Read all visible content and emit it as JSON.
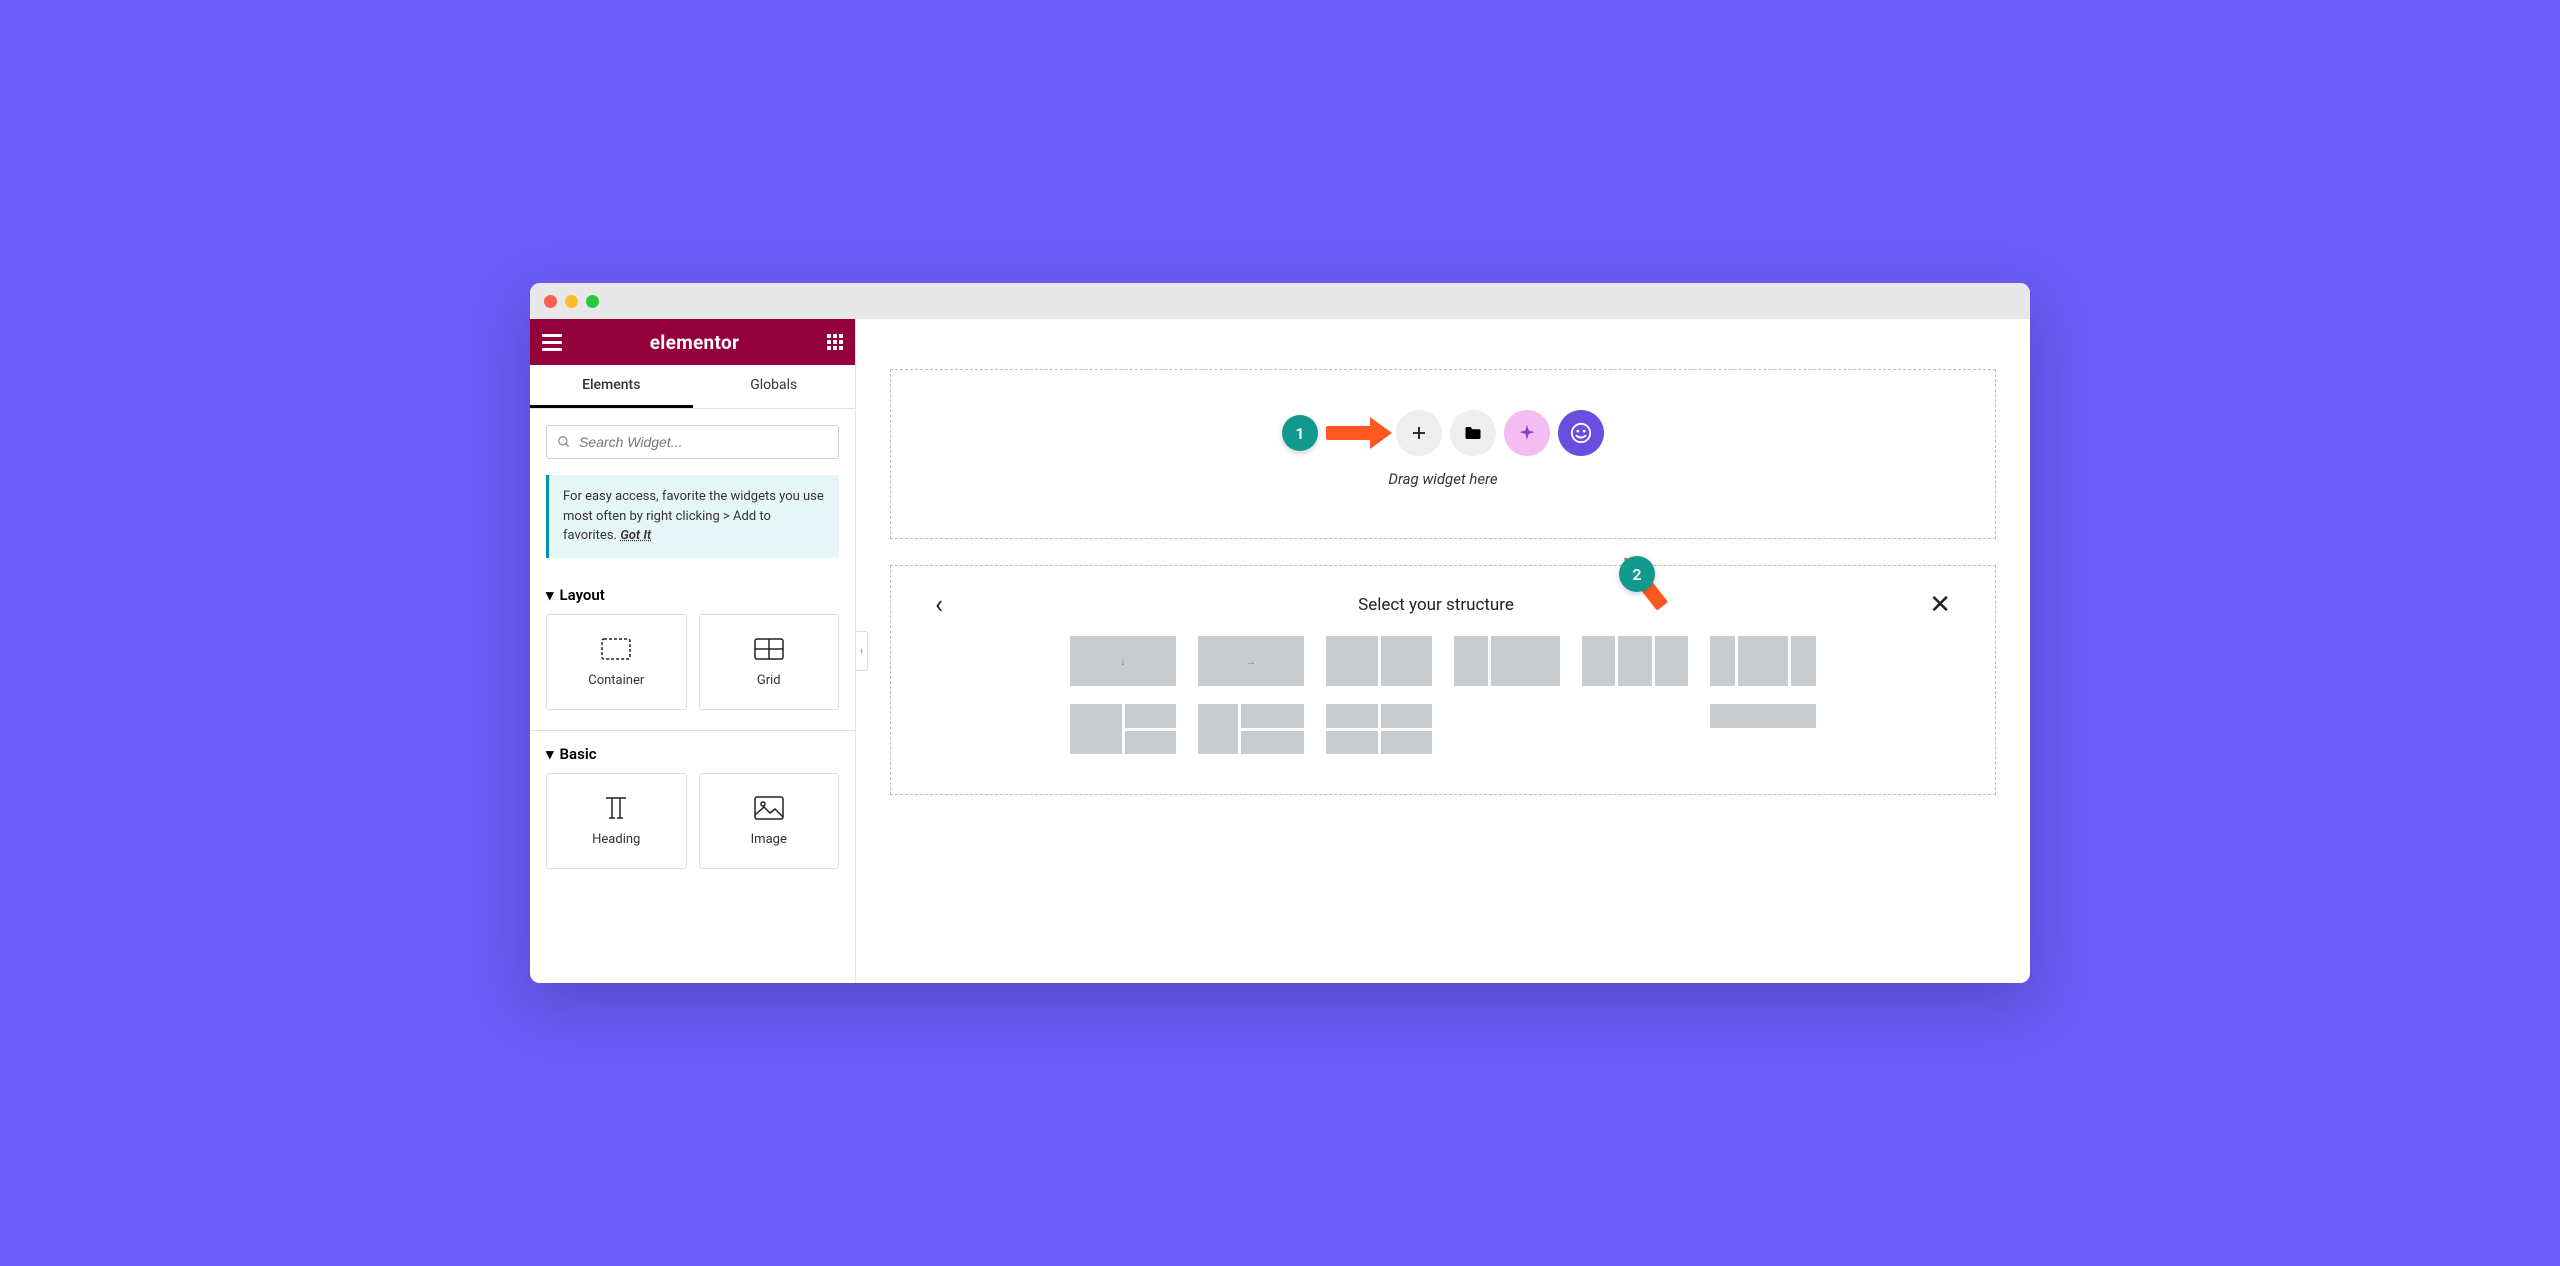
{
  "sidebar": {
    "title": "elementor",
    "tabs": {
      "elements": "Elements",
      "globals": "Globals"
    },
    "search_placeholder": "Search Widget...",
    "tip_text": "For easy access, favorite the widgets you use most often by right clicking > Add to favorites.",
    "tip_link": "Got It",
    "categories": {
      "layout": {
        "label": "Layout",
        "widgets": {
          "container": "Container",
          "grid": "Grid"
        }
      },
      "basic": {
        "label": "Basic",
        "widgets": {
          "heading": "Heading",
          "image": "Image"
        }
      }
    }
  },
  "canvas": {
    "drag_label": "Drag widget here",
    "structure_title": "Select your structure"
  },
  "annotations": {
    "badge1": "1",
    "badge2": "2"
  }
}
